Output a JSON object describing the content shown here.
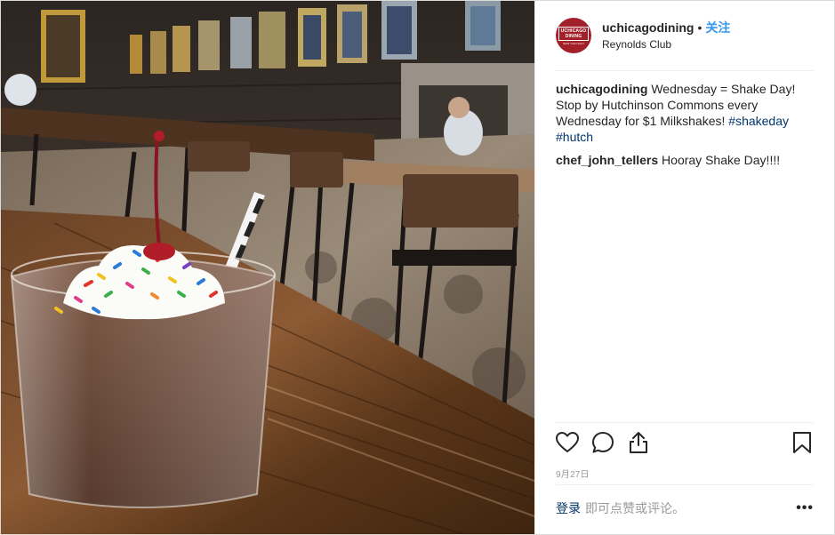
{
  "post": {
    "username": "uchicagodining",
    "separator": "•",
    "follow_label": "关注",
    "location": "Reynolds Club",
    "avatar": {
      "line1": "UCHICAGO",
      "line2": "DINING",
      "sub": "NEW CHICAGO"
    },
    "image_icon": "photo-milkshake-in-dining-hall",
    "comments": [
      {
        "user": "uchicagodining",
        "text": " Wednesday = Shake Day! Stop by Hutchinson Commons every Wednesday for $1 Milkshakes! ",
        "tags": [
          "#shakeday",
          "#hutch"
        ]
      },
      {
        "user": "chef_john_tellers",
        "text": " Hooray Shake Day!!!!"
      }
    ],
    "actions": {
      "like_icon": "heart-icon",
      "comment_icon": "comment-bubble-icon",
      "share_icon": "share-icon",
      "save_icon": "bookmark-icon"
    },
    "date": "9月27日",
    "footer": {
      "login_label": "登录",
      "comment_prompt": "即可点赞或评论。",
      "more_label": "•••"
    },
    "colors": {
      "follow": "#3897f0",
      "link": "#003569",
      "avatar_bg": "#a1202a",
      "muted": "#999999"
    }
  }
}
